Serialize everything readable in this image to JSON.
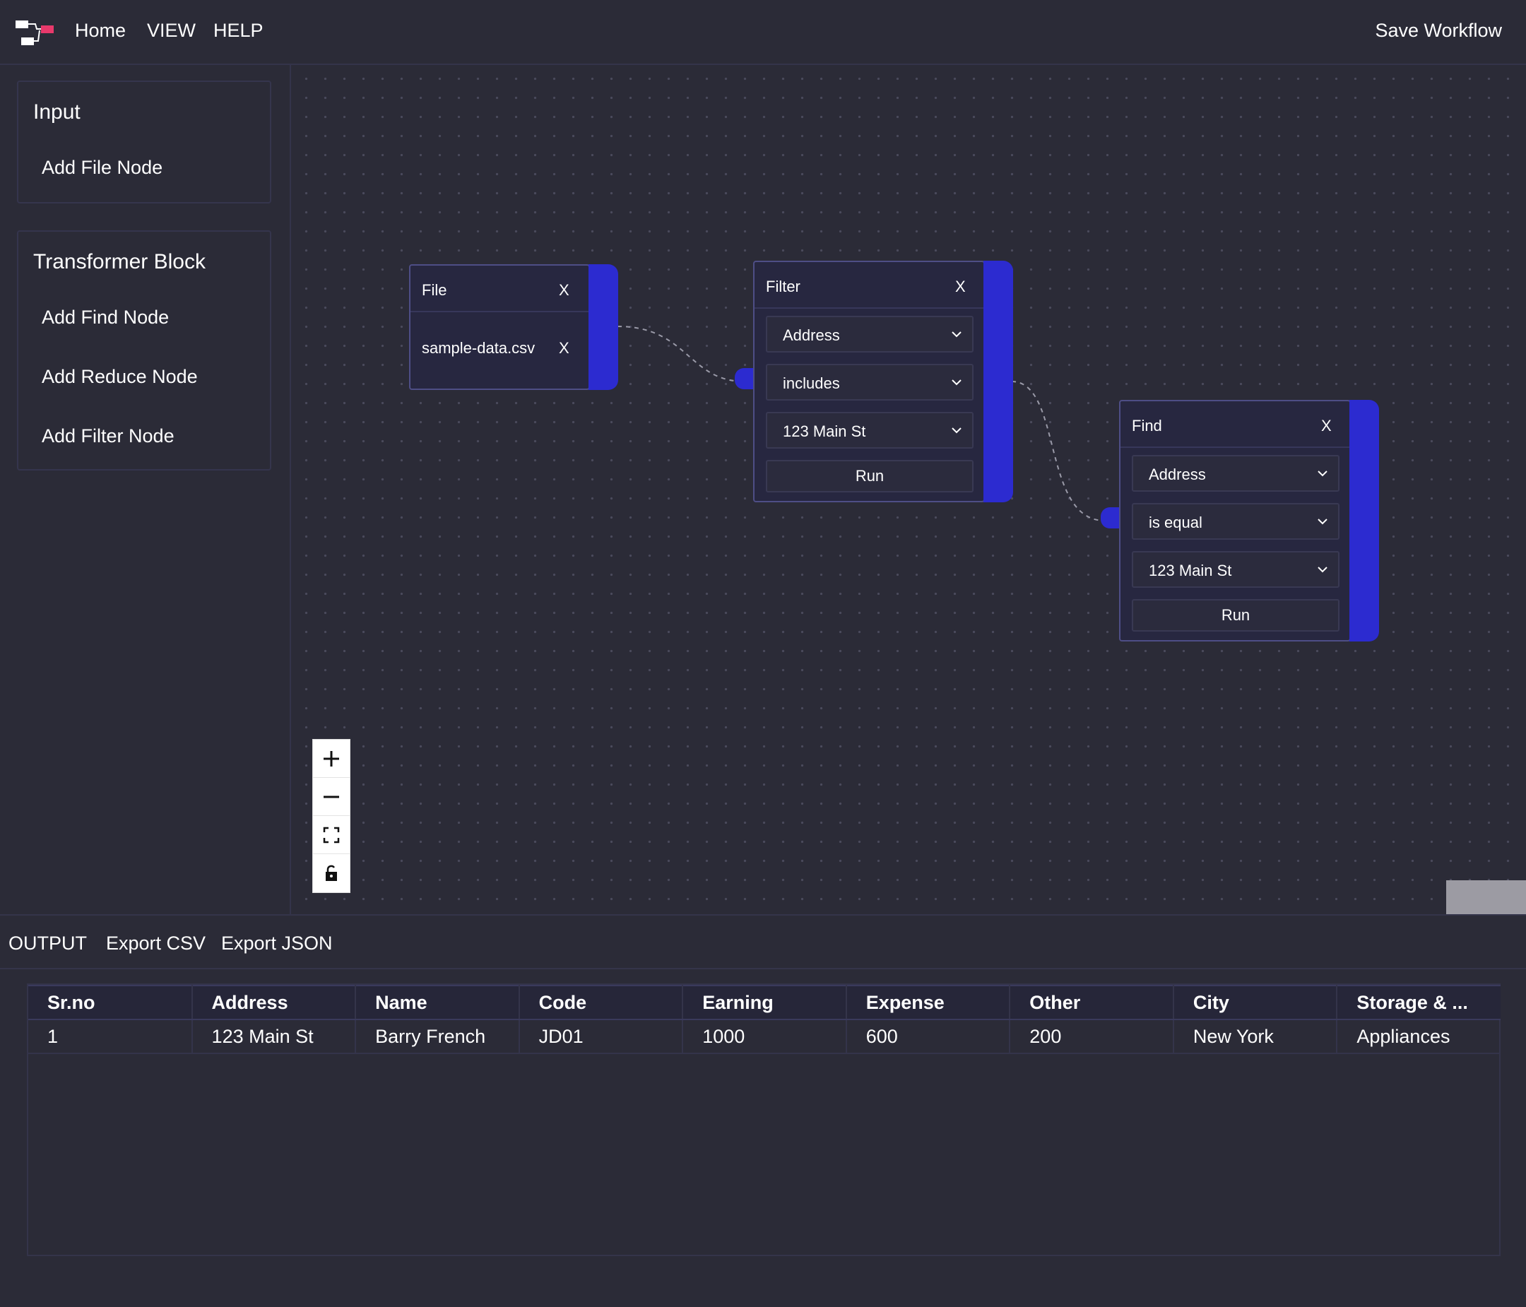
{
  "nav": {
    "logo": "flow-logo-icon",
    "links": [
      "Home",
      "VIEW",
      "HELP"
    ],
    "save": "Save Workflow"
  },
  "sidebar": {
    "input": {
      "title": "Input",
      "items": [
        "Add File Node"
      ]
    },
    "transformer": {
      "title": "Transformer Block",
      "items": [
        "Add Find Node",
        "Add Reduce Node",
        "Add Filter Node"
      ]
    }
  },
  "nodes": {
    "file": {
      "title": "File",
      "close": "X",
      "file_name": "sample-data.csv",
      "file_remove": "X"
    },
    "filter": {
      "title": "Filter",
      "close": "X",
      "column": "Address",
      "operator": "includes",
      "value": "123 Main St",
      "run": "Run"
    },
    "find": {
      "title": "Find",
      "close": "X",
      "column": "Address",
      "operator": "is equal",
      "value": "123 Main St",
      "run": "Run"
    }
  },
  "controls": [
    "zoom-in-icon",
    "zoom-out-icon",
    "fit-view-icon",
    "lock-icon"
  ],
  "output": {
    "label": "OUTPUT",
    "export_csv": "Export CSV",
    "export_json": "Export JSON",
    "columns": [
      "Sr.no",
      "Address",
      "Name",
      "Code",
      "Earning",
      "Expense",
      "Other",
      "City",
      "Storage & ..."
    ],
    "rows": [
      [
        "1",
        "123 Main St",
        "Barry French",
        "JD01",
        "1000",
        "600",
        "200",
        "New York",
        "Appliances"
      ]
    ]
  },
  "colors": {
    "background": "#2b2b37",
    "node_accent": "#2c2bd0",
    "node_border": "#4e4e86",
    "logo_accent": "#e8396b"
  }
}
